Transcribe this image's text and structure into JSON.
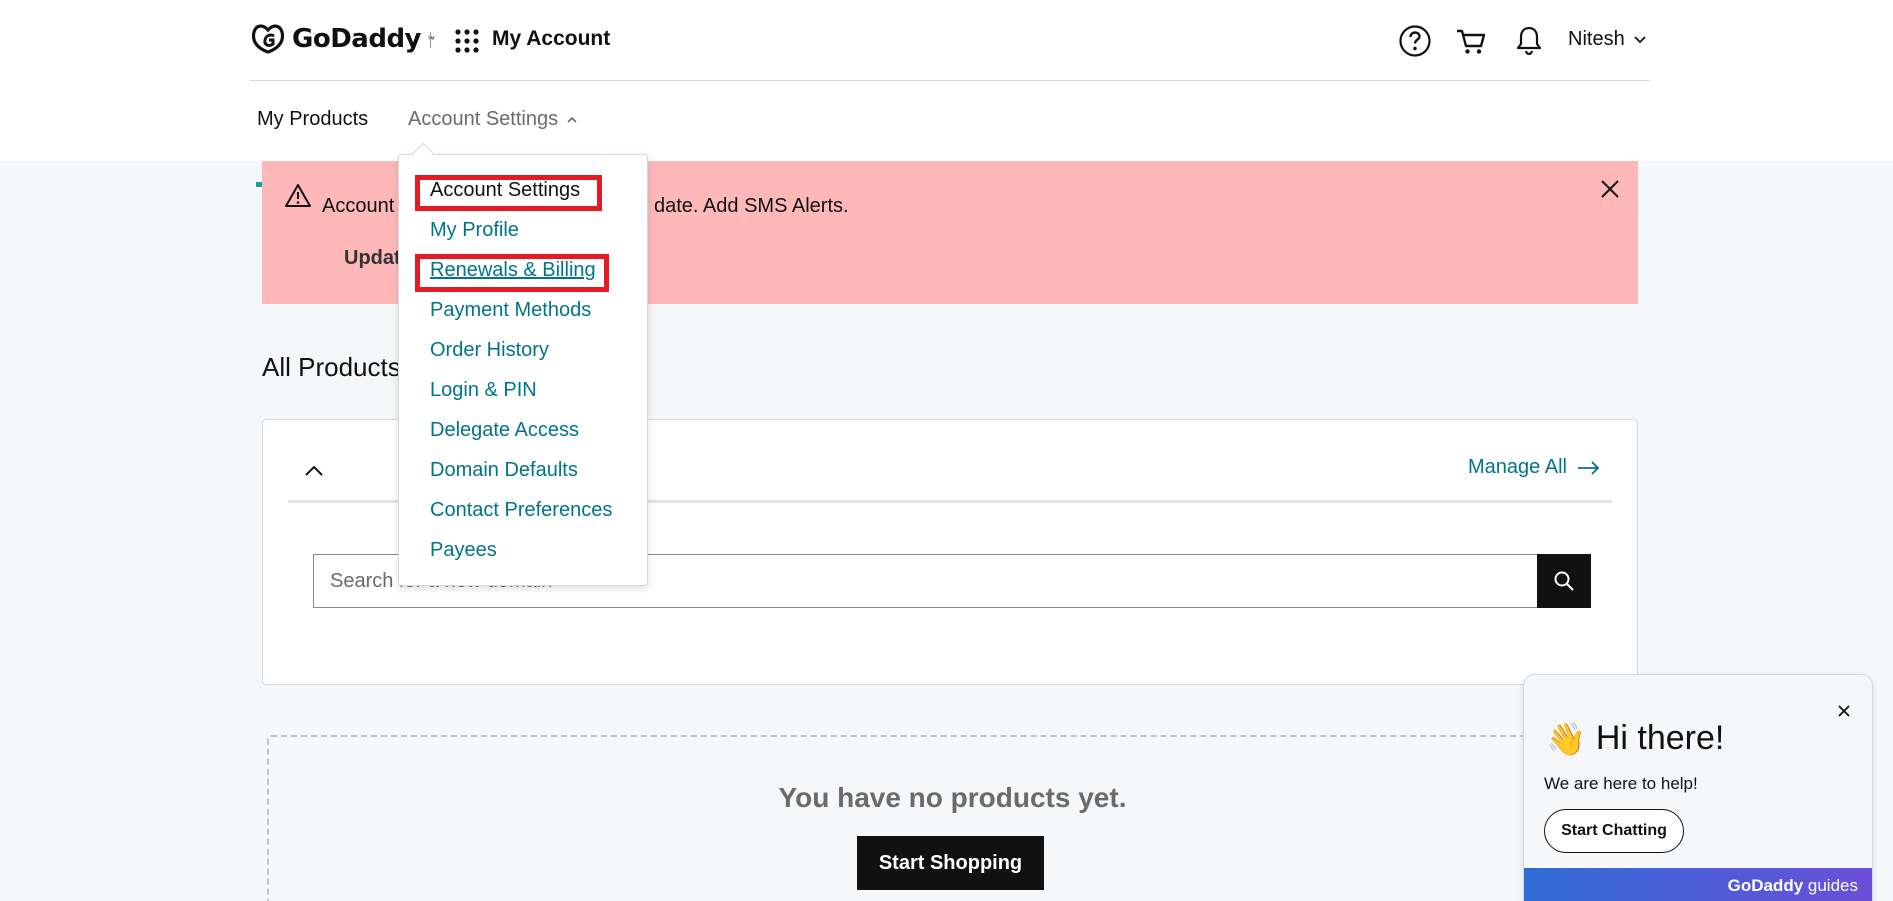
{
  "header": {
    "logo_text": "GoDaddy",
    "logo_tm": "™",
    "app_title": "My Account",
    "user_name": "Nitesh"
  },
  "tabs": [
    {
      "label": "My Products",
      "active": true
    },
    {
      "label": "Account Settings",
      "active": false
    }
  ],
  "alert": {
    "text_left": "Account",
    "text_right": "date. Add SMS Alerts.",
    "action": "Updat"
  },
  "main": {
    "section_title": "All Products",
    "manage_all": "Manage All",
    "search_placeholder": "Search for a new domain",
    "empty_message": "You have no products yet.",
    "start_shopping": "Start Shopping"
  },
  "dropdown": {
    "items": [
      {
        "label": "Account Settings",
        "highlighted": true
      },
      {
        "label": "My Profile"
      },
      {
        "label": "Renewals & Billing",
        "highlighted": true,
        "hovered": true
      },
      {
        "label": "Payment Methods"
      },
      {
        "label": "Order History"
      },
      {
        "label": "Login & PIN"
      },
      {
        "label": "Delegate Access"
      },
      {
        "label": "Domain Defaults"
      },
      {
        "label": "Contact Preferences"
      },
      {
        "label": "Payees"
      }
    ]
  },
  "chat": {
    "wave": "👋",
    "title": "Hi there!",
    "subtitle": "We are here to help!",
    "button": "Start Chatting",
    "footer_brand": "GoDaddy",
    "footer_suffix": "guides"
  },
  "colors": {
    "teal_link": "#00748a",
    "tab_underline": "#14a1a1",
    "alert_bg": "#ffb8b8",
    "highlight_red": "#e31b23"
  }
}
